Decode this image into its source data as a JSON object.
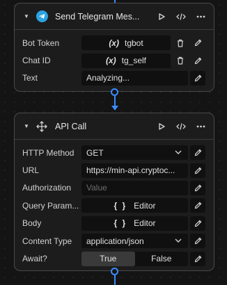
{
  "node1": {
    "title": "Send Telegram Mes...",
    "icon": "telegram-icon",
    "fields": {
      "bot_token": {
        "label": "Bot Token",
        "symbol": "(x)",
        "value": "tgbot"
      },
      "chat_id": {
        "label": "Chat ID",
        "symbol": "(x)",
        "value": "tg_self"
      },
      "text": {
        "label": "Text",
        "value": "Analyzing..."
      }
    }
  },
  "node2": {
    "title": "API Call",
    "icon": "move-icon",
    "fields": {
      "http_method": {
        "label": "HTTP Method",
        "value": "GET"
      },
      "url": {
        "label": "URL",
        "value": "https://min-api.cryptoc..."
      },
      "authorization": {
        "label": "Authorization",
        "placeholder": "Value"
      },
      "query_params": {
        "label": "Query Param...",
        "symbol": "{ }",
        "value": "Editor"
      },
      "body": {
        "label": "Body",
        "symbol": "{ }",
        "value": "Editor"
      },
      "content_type": {
        "label": "Content Type",
        "value": "application/json"
      },
      "await": {
        "label": "Await?",
        "true_label": "True",
        "false_label": "False",
        "selected": "True"
      }
    }
  },
  "colors": {
    "accent": "#3b8cff",
    "telegram": "#2aa3e0",
    "node_bg": "#1c1c1c",
    "field_bg": "#101010"
  }
}
